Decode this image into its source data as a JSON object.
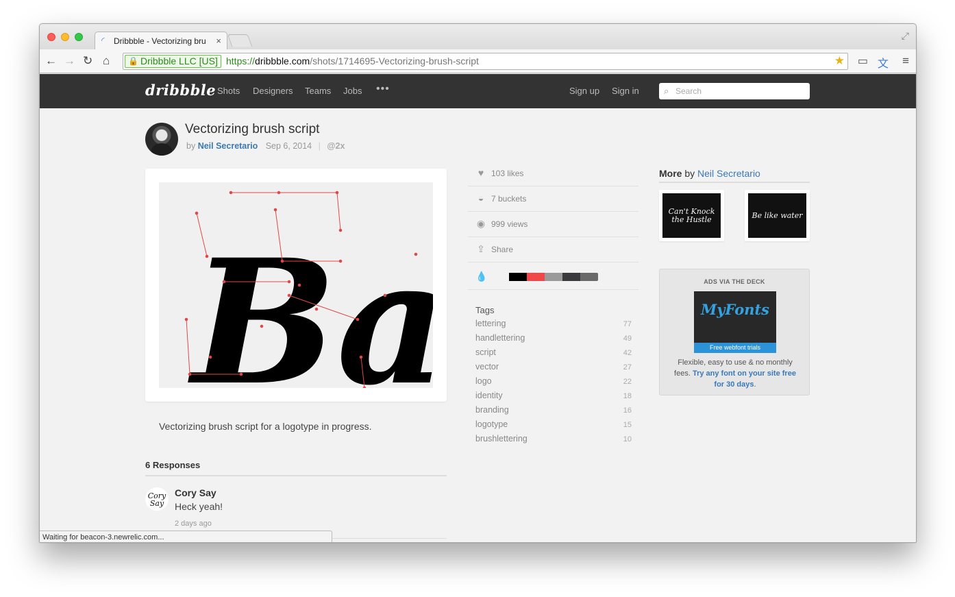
{
  "browser": {
    "tab_title": "Dribbble - Vectorizing bru",
    "tab_close": "×",
    "ev_cert": "Dribbble LLC [US]",
    "url_protocol": "https://",
    "url_host": "dribbble.com",
    "url_path": "/shots/1714695-Vectorizing-brush-script",
    "status_text": "Waiting for beacon-3.newrelic.com..."
  },
  "header": {
    "logo": "dribbble",
    "nav": [
      "Shots",
      "Designers",
      "Teams",
      "Jobs"
    ],
    "more": "•••",
    "sign_up": "Sign up",
    "sign_in": "Sign in",
    "search_placeholder": "Search"
  },
  "shot": {
    "title": "Vectorizing brush script",
    "by": "by",
    "author": "Neil Secretario",
    "date": "Sep 6, 2014",
    "separator": "|",
    "hidpi": "@2x",
    "image_text": "Bay",
    "description": "Vectorizing brush script for a logotype in progress."
  },
  "responses": {
    "title": "6 Responses",
    "items": [
      {
        "avatar_text": "Cory Say",
        "name": "Cory Say",
        "text": "Heck yeah!",
        "time": "2 days ago"
      }
    ]
  },
  "stats": {
    "likes": "103 likes",
    "buckets": "7 buckets",
    "views": "999 views",
    "share": "Share"
  },
  "palette": [
    "#f2f2f2",
    "#000000",
    "#f04848",
    "#9a9a9a",
    "#3a3a3e",
    "#6a6a6a"
  ],
  "tags": {
    "title": "Tags",
    "items": [
      {
        "name": "lettering",
        "count": "77"
      },
      {
        "name": "handlettering",
        "count": "49"
      },
      {
        "name": "script",
        "count": "42"
      },
      {
        "name": "vector",
        "count": "27"
      },
      {
        "name": "logo",
        "count": "22"
      },
      {
        "name": "identity",
        "count": "18"
      },
      {
        "name": "branding",
        "count": "16"
      },
      {
        "name": "logotype",
        "count": "15"
      },
      {
        "name": "brushlettering",
        "count": "10"
      }
    ]
  },
  "more_by": {
    "label": "More",
    "by": "by",
    "author": "Neil Secretario",
    "thumbs": [
      "Can't Knock the Hustle",
      "Be like water"
    ]
  },
  "ad": {
    "heading": "ADS VIA THE DECK",
    "logo": "MyFonts",
    "strip": "Free webfont trials",
    "text": "Flexible, easy to use & no monthly fees.",
    "cta": "Try any font on your site free for 30 days",
    "end": "."
  },
  "icons": {
    "likes": "heart-icon",
    "buckets": "bucket-icon",
    "views": "eye-icon",
    "share": "share-icon",
    "palette": "droplet-icon"
  }
}
